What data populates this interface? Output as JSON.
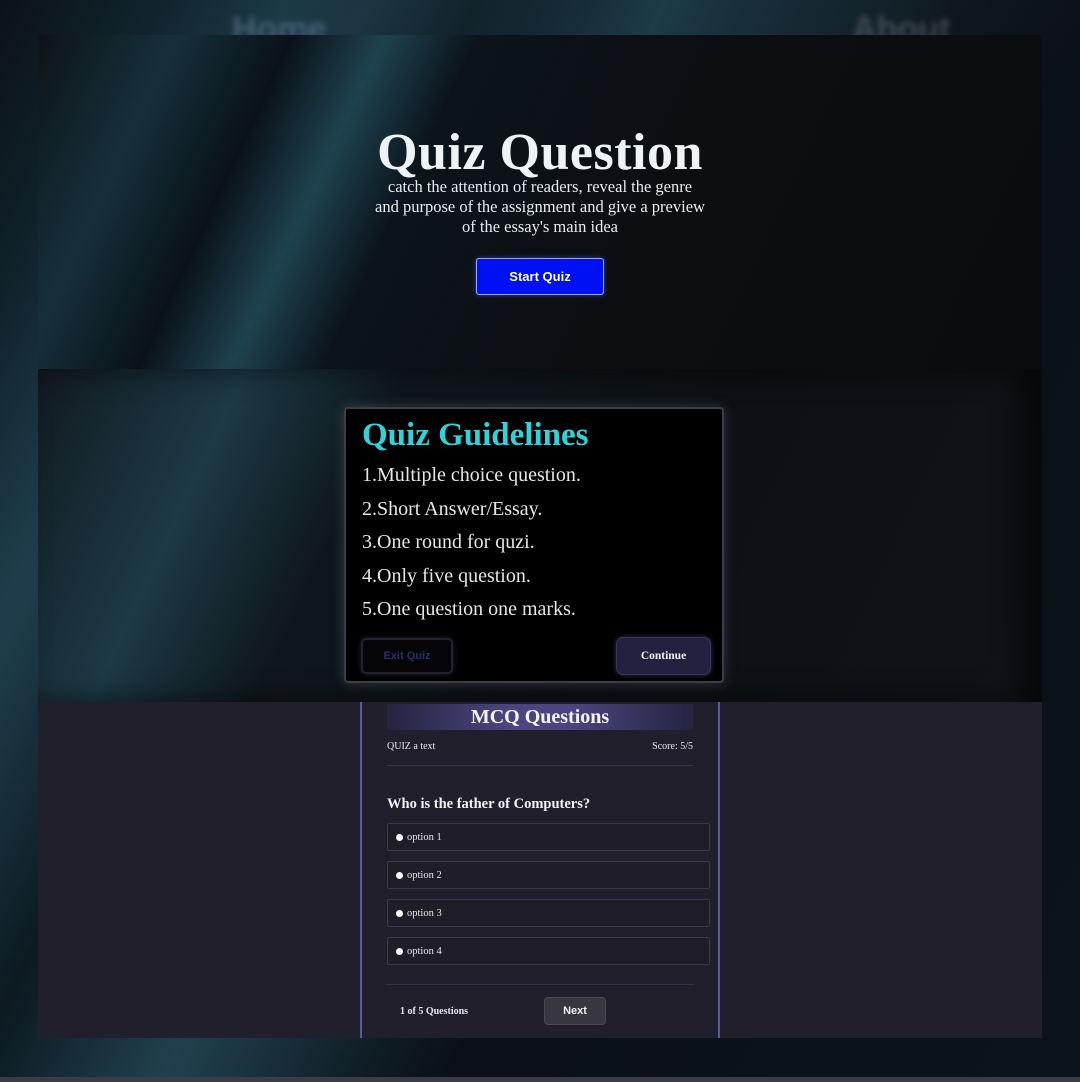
{
  "nav": {
    "home": "Home",
    "about": "About"
  },
  "hero": {
    "title": "Quiz Question",
    "description": "catch the attention of readers, reveal the genre and purpose of the assignment and give a preview of the essay's main idea",
    "start_button": "Start Quiz",
    "button_color": "#0010f5"
  },
  "guidelines": {
    "title": "Quiz Guidelines",
    "title_color": "#2ed3dc",
    "items": [
      "1.Multiple choice question.",
      "2.Short Answer/Essay.",
      "3.One round for quzi.",
      "4.Only five question.",
      "5.One question one marks."
    ],
    "exit_button": "Exit Quiz",
    "continue_button": "Continue"
  },
  "mcq": {
    "header": "MCQ Questions",
    "quiz_label": "QUIZ a text",
    "score": "Score: 5/5",
    "question": "Who is the father of Computers?",
    "options": [
      "option 1",
      "option 2",
      "option 3",
      "option 4"
    ],
    "progress": "1 of 5 Questions",
    "next_button": "Next"
  }
}
